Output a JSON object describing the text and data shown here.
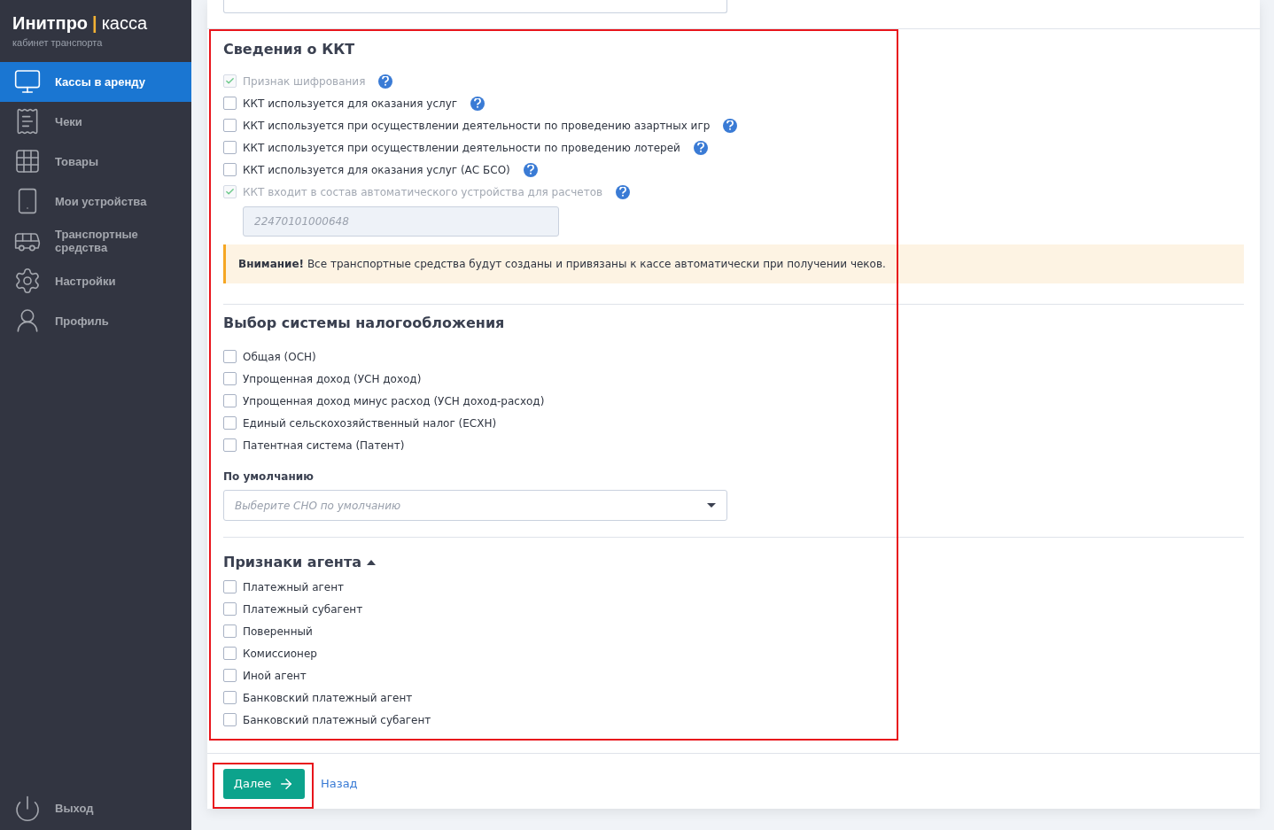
{
  "brand": {
    "name": "Инитпро",
    "separator": "|",
    "product": "касса",
    "subtitle": "кабинет транспорта"
  },
  "sidebar": {
    "items": [
      {
        "label": "Кассы в аренду",
        "selected": true
      },
      {
        "label": "Чеки",
        "selected": false
      },
      {
        "label": "Товары",
        "selected": false
      },
      {
        "label": "Мои устройства",
        "selected": false
      },
      {
        "label": "Транспортные средства",
        "selected": false
      },
      {
        "label": "Настройки",
        "selected": false
      },
      {
        "label": "Профиль",
        "selected": false
      }
    ],
    "logout": {
      "label": "Выход"
    }
  },
  "kkt": {
    "title": "Сведения о ККТ",
    "options": [
      {
        "label": "Признак шифрования",
        "checked": true,
        "disabled": true
      },
      {
        "label": "ККТ используется для оказания услуг",
        "checked": false,
        "disabled": false
      },
      {
        "label": "ККТ используется при осуществлении деятельности по проведению азартных игр",
        "checked": false,
        "disabled": false
      },
      {
        "label": "ККТ используется при осуществлении деятельности по проведению лотерей",
        "checked": false,
        "disabled": false
      },
      {
        "label": "ККТ используется для оказания услуг (АС БСО)",
        "checked": false,
        "disabled": false
      },
      {
        "label": "ККТ входит в состав автоматического устройства для расчетов",
        "checked": true,
        "disabled": true
      }
    ],
    "device_number": {
      "placeholder": "22470101000648"
    },
    "alert": {
      "text": "**Внимание!** Все транспортные средства будут созданы и привязаны к кассе автоматически при получении чеков."
    }
  },
  "tax": {
    "title": "Выбор системы налогообложения",
    "options": [
      {
        "label": "Общая (ОСН)",
        "checked": false
      },
      {
        "label": "Упрощенная доход (УСН доход)",
        "checked": false
      },
      {
        "label": "Упрощенная доход минус расход (УСН доход-расход)",
        "checked": false
      },
      {
        "label": "Единый сельскохозяйственный налог (ЕСХН)",
        "checked": false
      },
      {
        "label": "Патентная система (Патент)",
        "checked": false
      }
    ],
    "default_label": "По умолчанию",
    "default_select": {
      "placeholder": "Выберите СНО по умолчанию"
    }
  },
  "agent": {
    "title": "Признаки агента",
    "expanded": true,
    "options": [
      {
        "label": "Платежный агент",
        "checked": false
      },
      {
        "label": "Платежный субагент",
        "checked": false
      },
      {
        "label": "Поверенный",
        "checked": false
      },
      {
        "label": "Комиссионер",
        "checked": false
      },
      {
        "label": "Иной агент",
        "checked": false
      },
      {
        "label": "Банковский платежный агент",
        "checked": false
      },
      {
        "label": "Банковский платежный субагент",
        "checked": false
      }
    ]
  },
  "footer": {
    "next_button": "Далее",
    "back_link": "Назад"
  },
  "highlights": {
    "form": true,
    "next_button": true
  }
}
